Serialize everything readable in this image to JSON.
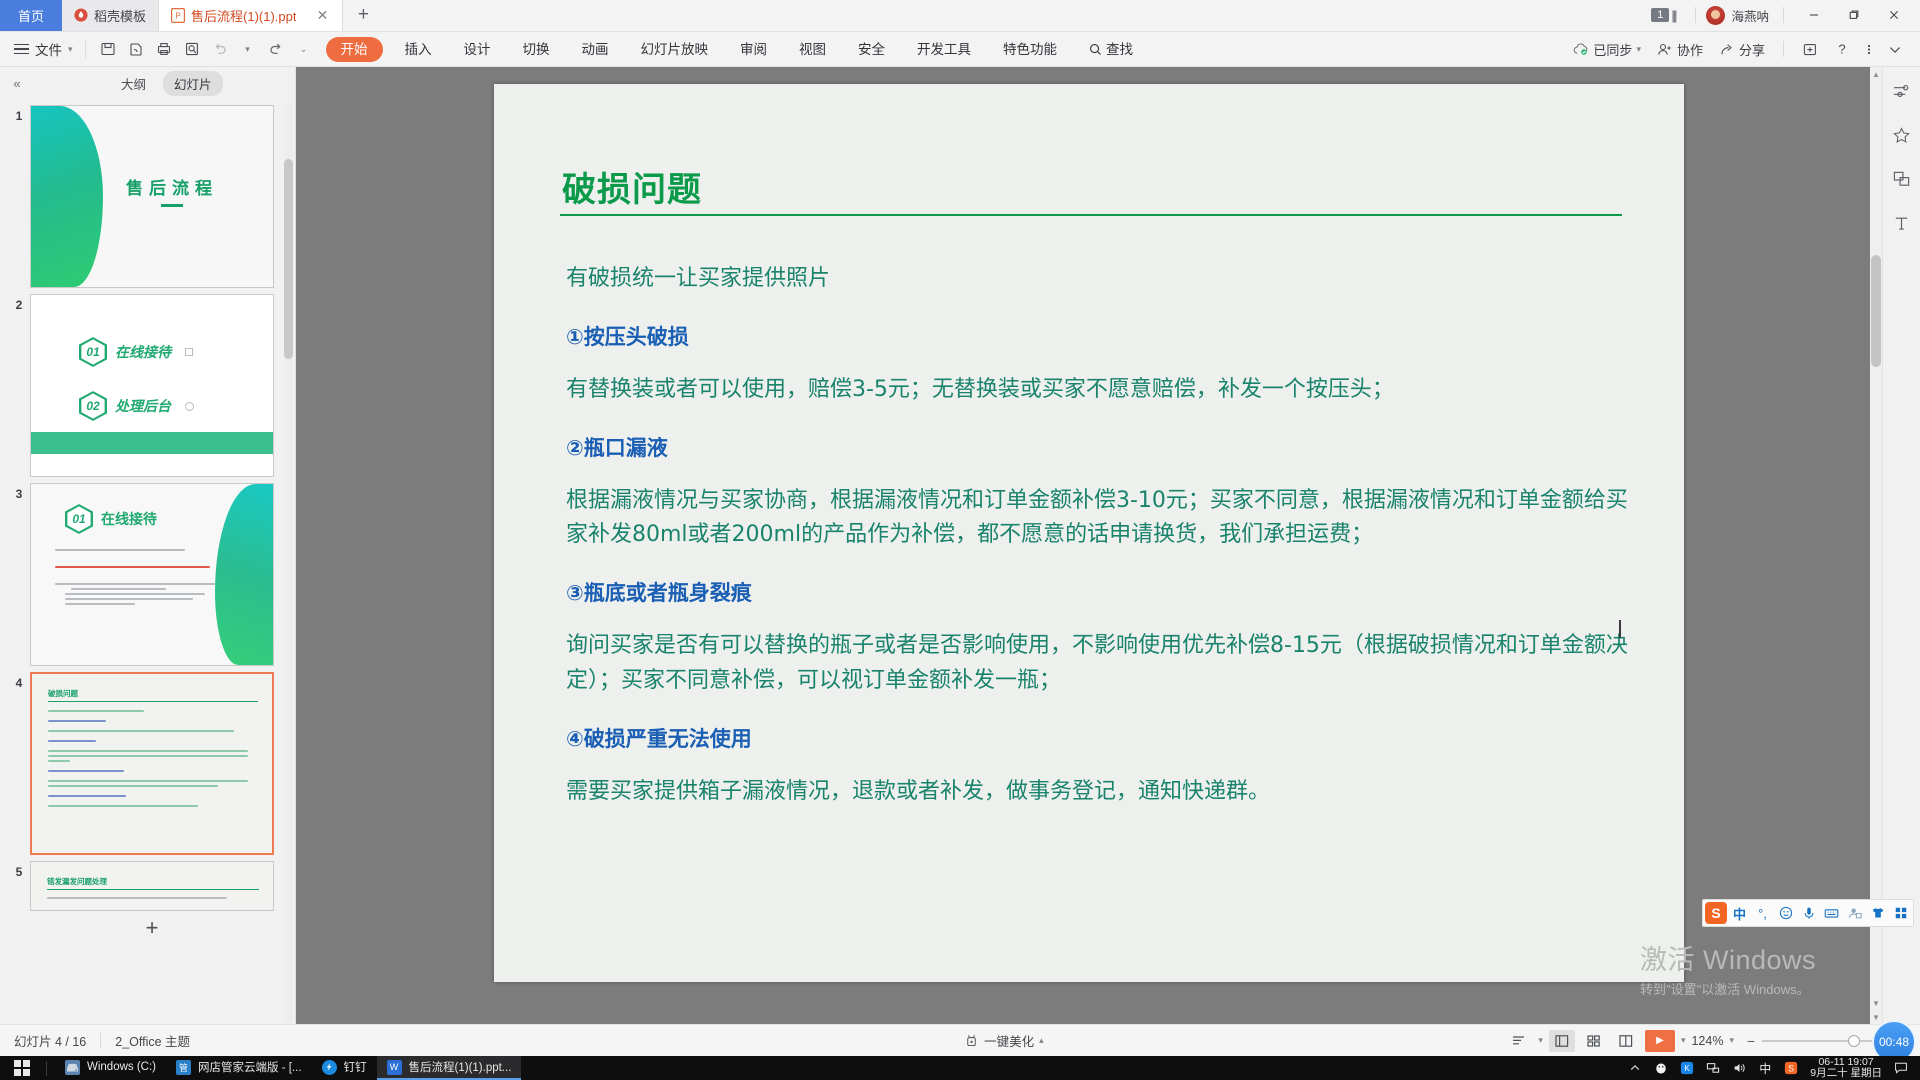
{
  "titlebar": {
    "home_tab": "首页",
    "tabs": [
      {
        "label": "稻壳模板",
        "icon": "docer-icon"
      },
      {
        "label": "售后流程(1)(1).ppt",
        "icon": "ppt-icon"
      }
    ],
    "add_tab": "+",
    "close_glyph": "✕",
    "sheet_badge": "1",
    "user_name": "海燕呐",
    "minimize": "—",
    "restore": "❐",
    "close": "✕"
  },
  "menubar": {
    "file": "文件",
    "quick_icons": [
      "save-icon",
      "save-as-icon",
      "print-icon",
      "print-preview-icon",
      "undo-icon",
      "redo-icon",
      "customize-icon"
    ],
    "tabs": [
      {
        "label": "开始",
        "active": true
      },
      {
        "label": "插入",
        "active": false
      },
      {
        "label": "设计",
        "active": false
      },
      {
        "label": "切换",
        "active": false
      },
      {
        "label": "动画",
        "active": false
      },
      {
        "label": "幻灯片放映",
        "active": false
      },
      {
        "label": "审阅",
        "active": false
      },
      {
        "label": "视图",
        "active": false
      },
      {
        "label": "安全",
        "active": false
      },
      {
        "label": "开发工具",
        "active": false
      },
      {
        "label": "特色功能",
        "active": false
      }
    ],
    "find": "查找",
    "right_items": [
      {
        "label": "已同步",
        "icon": "cloud-sync-icon"
      },
      {
        "label": "协作",
        "icon": "collaborate-icon"
      },
      {
        "label": "分享",
        "icon": "share-icon"
      }
    ],
    "right_icons": [
      "new-tab-icon",
      "help-icon",
      "more-icon",
      "collapse-ribbon-icon"
    ]
  },
  "leftpanel": {
    "collapse": "«",
    "tabs": [
      {
        "label": "大纲",
        "active": false
      },
      {
        "label": "幻灯片",
        "active": true
      }
    ],
    "slides": [
      {
        "num": "1",
        "title": "售后流程",
        "selected": false
      },
      {
        "num": "2",
        "items": [
          "在线接待",
          "处理后台"
        ],
        "nums": [
          "01",
          "02"
        ],
        "selected": false
      },
      {
        "num": "3",
        "badge": "01",
        "title": "在线接待",
        "selected": false
      },
      {
        "num": "4",
        "title": "破损问题",
        "selected": true
      },
      {
        "num": "5",
        "title": "错发漏发问题处理",
        "selected": false
      }
    ],
    "add_slide": "+"
  },
  "slide": {
    "title": "破损问题",
    "title_color": "#0a9a4a",
    "heading_color": "#1a5fb4",
    "body_color": "#19836c",
    "blocks": [
      {
        "type": "text",
        "text": "有破损统一让买家提供照片"
      },
      {
        "type": "head",
        "text": "①按压头破损"
      },
      {
        "type": "text",
        "text": "有替换装或者可以使用，赔偿3-5元；无替换装或买家不愿意赔偿，补发一个按压头；"
      },
      {
        "type": "head",
        "text": "②瓶口漏液"
      },
      {
        "type": "text",
        "text": "根据漏液情况与买家协商，根据漏液情况和订单金额补偿3-10元；买家不同意，根据漏液情况和订单金额给买家补发80ml或者200ml的产品作为补偿，都不愿意的话申请换货，我们承担运费；"
      },
      {
        "type": "head",
        "text": "③瓶底或者瓶身裂痕"
      },
      {
        "type": "text",
        "text": "询问买家是否有可以替换的瓶子或者是否影响使用，不影响使用优先补偿8-15元（根据破损情况和订单金额决定）；买家不同意补偿，可以视订单金额补发一瓶；"
      },
      {
        "type": "head",
        "text": "④破损严重无法使用"
      },
      {
        "type": "text",
        "text": "需要买家提供箱子漏液情况，退款或者补发，做事务登记，通知快递群。"
      }
    ]
  },
  "rail": {
    "icons": [
      "adjust-sliders-icon",
      "effects-star-icon",
      "shapes-icon",
      "text-box-icon"
    ]
  },
  "statusbar": {
    "slide_counter": "幻灯片 4 / 16",
    "theme": "2_Office 主题",
    "beautify": "一键美化",
    "view_icons": [
      "outline-view-icon",
      "normal-view-icon",
      "slide-sorter-icon",
      "reading-view-icon"
    ],
    "play": "▶",
    "zoom_level": "124%",
    "zoom_minus": "−",
    "zoom_plus": "+"
  },
  "taskbar": {
    "start": "start-icon",
    "tasks": [
      {
        "label": "Windows (C:)",
        "icon": "drive-icon",
        "active": false
      },
      {
        "label": "网店管家云端版 - [...",
        "icon": "wdgj-icon",
        "active": false
      },
      {
        "label": "钉钉",
        "icon": "dingtalk-icon",
        "active": false
      },
      {
        "label": "售后流程(1)(1).ppt...",
        "icon": "wps-ppt-icon",
        "active": true
      }
    ],
    "tray_icons": [
      "show-hidden-icon",
      "qq-icon",
      "kingsoft-icon",
      "network-icon",
      "volume-icon",
      "ime-cn-icon",
      "sogou-icon"
    ],
    "clock_time": "06-11 19:07",
    "clock_date": "9月二十 星期日",
    "action_center": "notification-icon"
  },
  "ime": {
    "logo": "S",
    "mode": "中",
    "icons": [
      "halfwidth-icon",
      "emoji-icon",
      "voice-icon",
      "keyboard-icon",
      "user-icon",
      "skin-icon",
      "toolbox-icon"
    ]
  },
  "watermark": {
    "line1": "激活 Windows",
    "line2": "转到\"设置\"以激活 Windows。"
  },
  "timer": {
    "value": "00:48"
  }
}
